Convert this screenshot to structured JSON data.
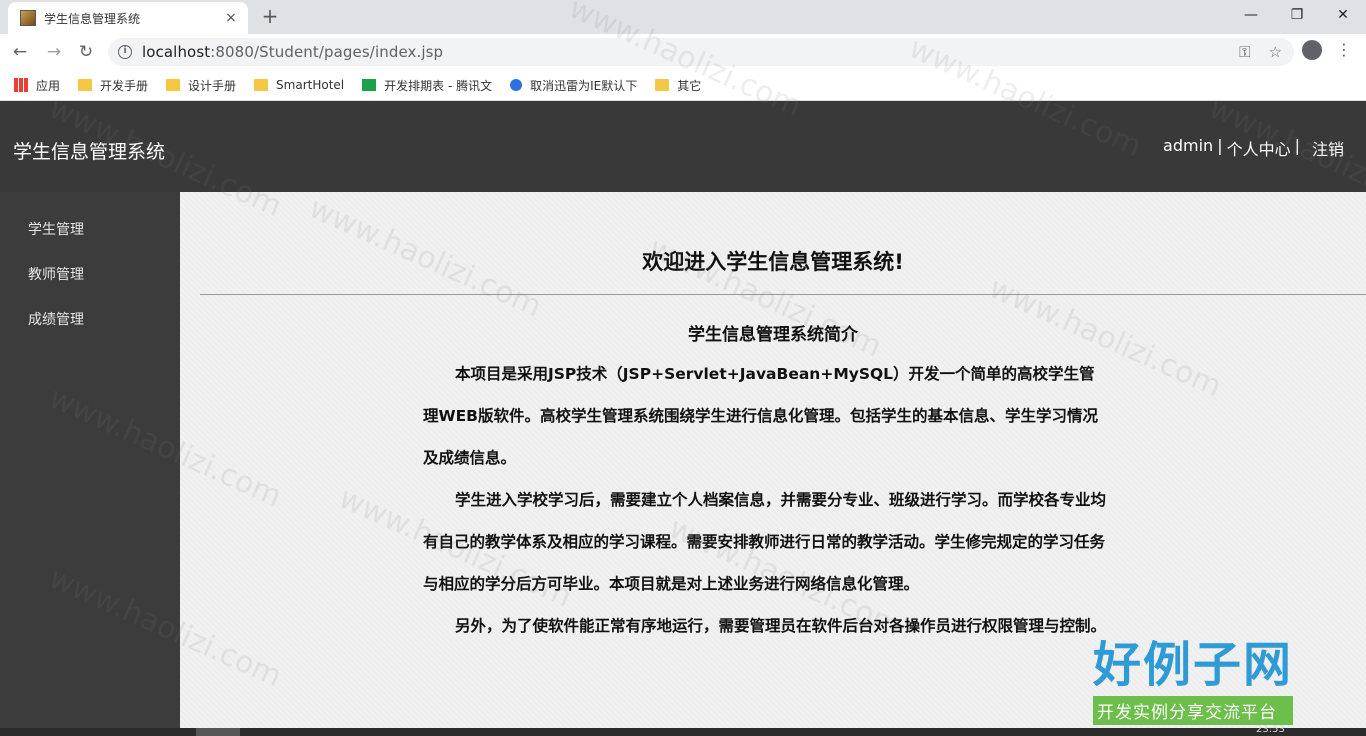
{
  "browser": {
    "tab_title": "学生信息管理系统",
    "tab_close": "×",
    "new_tab": "+",
    "window_controls": [
      "—",
      "❐",
      "✕"
    ],
    "url_host": "localhost",
    "url_path": ":8080/Student/pages/index.jsp",
    "bookmarks": [
      "应用",
      "开发手册",
      "设计手册",
      "SmartHotel",
      "开发排期表 - 腾讯文",
      "取消迅雷为IE默认下",
      "其它"
    ]
  },
  "header": {
    "app_title": "学生信息管理系统",
    "user": "admin",
    "profile_link": "个人中心",
    "logout": "注销",
    "separator": "|"
  },
  "sidebar": {
    "items": [
      "学生管理",
      "教师管理",
      "成绩管理"
    ]
  },
  "main": {
    "welcome": "欢迎进入学生信息管理系统!",
    "intro_title": "学生信息管理系统简介",
    "paragraphs": [
      "本项目是采用JSP技术（JSP+Servlet+JavaBean+MySQL）开发一个简单的高校学生管理WEB版软件。高校学生管理系统围绕学生进行信息化管理。包括学生的基本信息、学生学习情况及成绩信息。",
      "学生进入学校学习后，需要建立个人档案信息，并需要分专业、班级进行学习。而学校各专业均有自己的教学体系及相应的学习课程。需要安排教师进行日常的教学活动。学生修完规定的学习任务与相应的学分后方可毕业。本项目就是对上述业务进行网络信息化管理。",
      "另外，为了使软件能正常有序地运行，需要管理员在软件后台对各操作员进行权限管理与控制。"
    ]
  },
  "watermark": {
    "text": "www.haolizi.com",
    "brand_big": "好例子网",
    "brand_sub": "开发实例分享交流平台"
  },
  "taskbar": {
    "clock": "23:53"
  }
}
